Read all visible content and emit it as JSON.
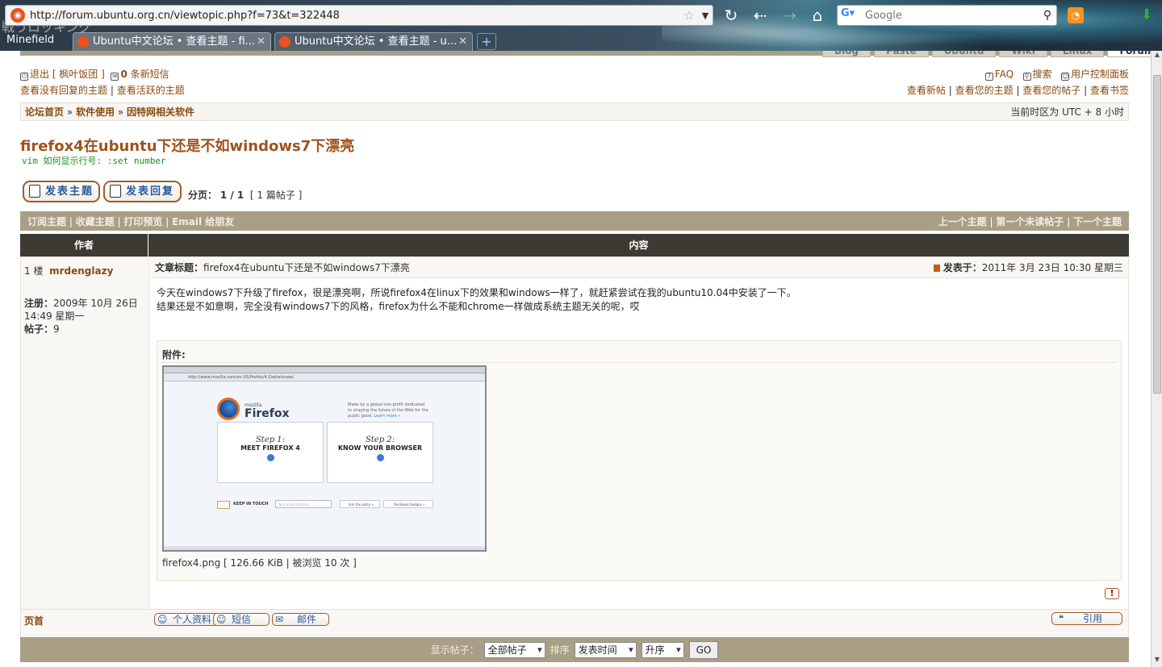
{
  "browser": {
    "url": "http://forum.ubuntu.org.cn/viewtopic.php?f=73&t=322448",
    "search_placeholder": "Google",
    "app_menu": "Minefield",
    "watermark": "戦うロッキング",
    "tabs": [
      {
        "label": "Ubuntu中文论坛 • 查看主题 - fi..."
      },
      {
        "label": "Ubuntu中文论坛 • 查看主题 - u..."
      }
    ]
  },
  "site_nav": {
    "tabs": [
      "Blog",
      "Paste",
      "Ubuntu",
      "Wiki",
      "Linux",
      "Forum"
    ]
  },
  "userbar": {
    "logout": "退出 [ 枫叶饭团 ]",
    "pm_count": "0",
    "pm_label": "条新短信",
    "faq": "FAQ",
    "search": "搜索",
    "ucp": "用户控制面板",
    "unanswered": "查看没有回复的主题",
    "active": "查看活跃的主题",
    "new_posts": "查看新帖",
    "your_topics": "查看您的主题",
    "your_posts": "查看您的帖子",
    "bookmarks": "查看书签"
  },
  "breadcrumb": {
    "home": "论坛首页",
    "cat": "软件使用",
    "forum": "因特网相关软件",
    "timezone": "当前时区为 UTC + 8 小时"
  },
  "topic": {
    "title": "firefox4在ubuntu下还是不如windows7下漂亮",
    "signature_line": "vim 如何显示行号: :set number",
    "new_topic": "发表主题",
    "reply": "发表回复",
    "pager_label": "分页：",
    "pager_value": "1 / 1",
    "post_count": "[ 1 篇帖子 ]"
  },
  "actions": {
    "subscribe": "订阅主题",
    "bookmark": "收藏主题",
    "print": "打印预览",
    "email": "Email 给朋友",
    "prev": "上一个主题",
    "first_unread": "第一个未读帖子",
    "next": "下一个主题"
  },
  "table_head": {
    "author": "作者",
    "content": "内容"
  },
  "post": {
    "floor": "1 楼",
    "author": "mrdenglazy",
    "joined_label": "注册：",
    "joined": "2009年 10月 26日 14:49 星期一",
    "posts_label": "帖子：",
    "posts": "9",
    "subject_label": "文章标题：",
    "subject": "firefox4在ubuntu下还是不如windows7下漂亮",
    "posted_label": "发表于：",
    "posted": "2011年 3月 23日 10:30 星期三",
    "body_line1": "今天在windows7下升级了firefox，很是漂亮啊，所说firefox4在linux下的效果和windows一样了，就赶紧尝试在我的ubuntu10.04中安装了一下。",
    "body_line2": "结果还是不如意啊，完全没有windows7下的风格，firefox为什么不能和chrome一样做成系统主题无关的呢，哎",
    "attach_label": "附件:",
    "attach_caption": "firefox4.png [ 126.66 KiB | 被浏览 10 次 ]",
    "top": "页首",
    "profile": "个人资料",
    "pm": "短信",
    "mail": "邮件",
    "quote": "引用"
  },
  "screenshot_thumb": {
    "url": "http://www.mozilla.com/en-US/firefox/4.0/whatsnew/",
    "brand_small": "mozilla",
    "brand": "Firefox",
    "tagline": "Made by a global non-profit dedicated to shaping the future of the Web for the public good.",
    "learn_more": "Learn more »",
    "step1_num": "Step 1:",
    "step1": "MEET FIREFOX 4",
    "step2_num": "Step 2:",
    "step2": "KNOW YOUR BROWSER",
    "keep": "KEEP IN TOUCH",
    "email_ph": "Your email address",
    "party": "Join the party »",
    "badges": "Facebook badges »"
  },
  "filter": {
    "show_label": "显示帖子：",
    "show_value": "全部帖子",
    "sort_label": "排序",
    "sort_value": "发表时间",
    "order_value": "升序",
    "go": "GO"
  }
}
